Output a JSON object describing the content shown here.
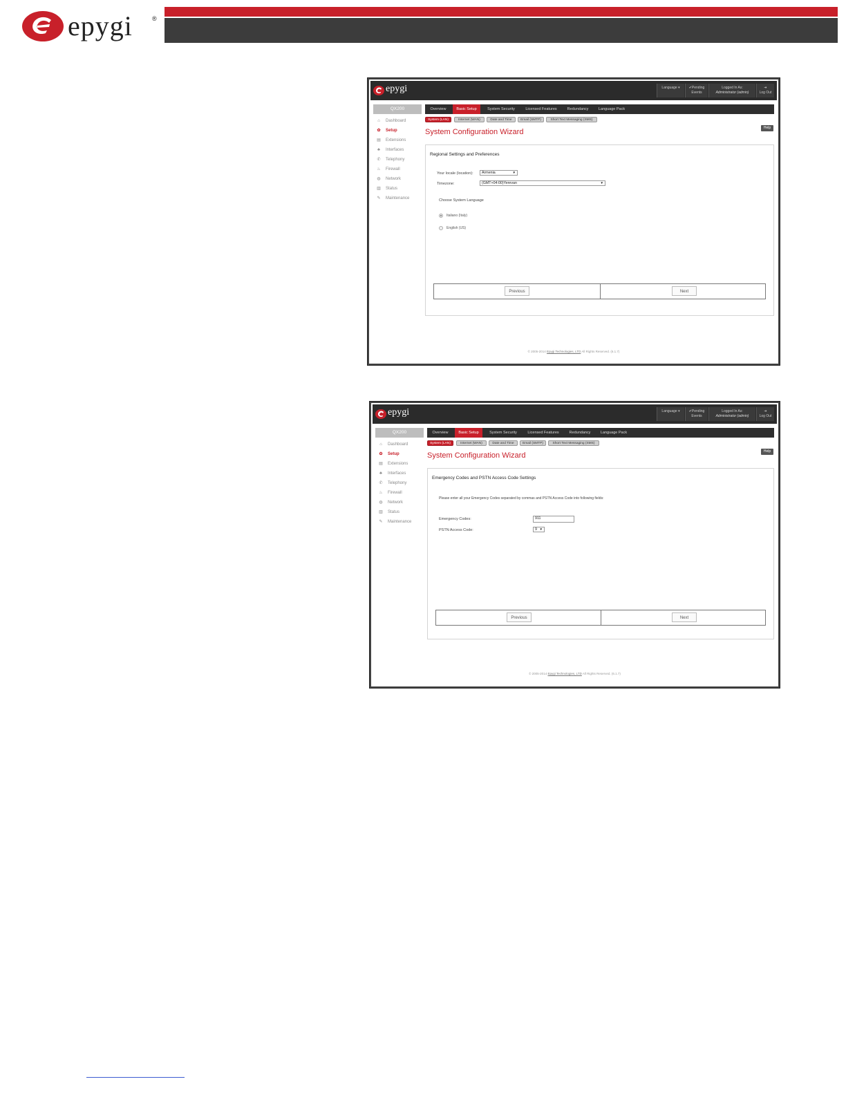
{
  "brand": {
    "name": "epygi",
    "registered": "®",
    "color_red": "#c8202a",
    "color_dark": "#3c3c3c"
  },
  "app": {
    "logo_text": "epygi",
    "header": {
      "language_label": "Language",
      "pending_events_label": "✔Pending Events",
      "logged_in_label": "Logged In As:",
      "logged_in_user": "Administrator (admin)",
      "logout_label": "Log Out"
    },
    "tabs": [
      "Overview",
      "Basic Setup",
      "System Security",
      "Licensed Features",
      "Redundancy",
      "Language Pack"
    ],
    "subtabs": [
      "System (LAN)",
      "Internet (WAN)",
      "Date and Time",
      "Email (SMTP)",
      "Short Text Messaging (SMS)"
    ],
    "sidebar": [
      {
        "label": "Dashboard",
        "icon": "dashboard-icon"
      },
      {
        "label": "Setup",
        "icon": "gear-icon"
      },
      {
        "label": "Extensions",
        "icon": "extensions-icon"
      },
      {
        "label": "Interfaces",
        "icon": "interfaces-icon"
      },
      {
        "label": "Telephony",
        "icon": "phone-icon"
      },
      {
        "label": "Firewall",
        "icon": "fire-icon"
      },
      {
        "label": "Network",
        "icon": "globe-icon"
      },
      {
        "label": "Status",
        "icon": "chart-icon"
      },
      {
        "label": "Maintenance",
        "icon": "wrench-icon"
      }
    ],
    "wizard_title": "System Configuration Wizard",
    "help_label": "Help",
    "previous_label": "Previous",
    "next_label": "Next",
    "copyright_prefix": "© 2005-2014",
    "copyright_company": "Epygi Technologies, LTD",
    "copyright_suffix": "All Rights Reserved. (6.1.7)"
  },
  "shot1": {
    "device": "QX200",
    "panel_title": "Regional Settings and Preferences",
    "locale_label": "Your locale (location):",
    "locale_value": "Armenia",
    "timezone_label": "Timezone:",
    "timezone_value": "(GMT+04:00)Yerevan",
    "language_heading": "Choose System Language",
    "lang_option_1": "Italiano (Italy)",
    "lang_option_2": "English (US)"
  },
  "shot2": {
    "device": "QX200",
    "panel_title": "Emergency Codes and PSTN Access Code Settings",
    "instructions": "Please enter all your Emergency Codes separated by commas and PSTN Access Code into following fields:",
    "emergency_label": "Emergency Codes:",
    "emergency_value": "911",
    "pstn_label": "PSTN Access Code:",
    "pstn_value": "9"
  }
}
